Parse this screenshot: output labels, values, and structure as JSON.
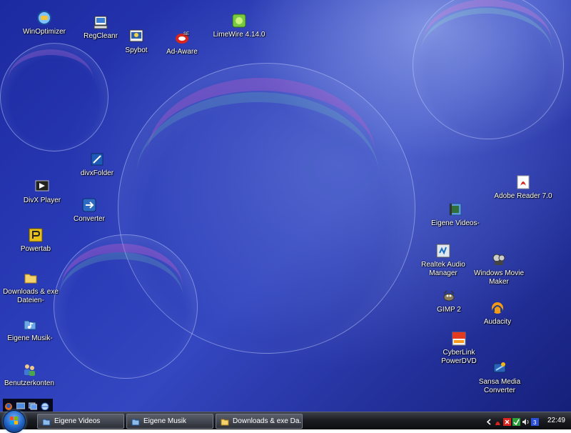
{
  "desktop": {
    "icons": [
      {
        "label": "WinOptimizer",
        "icon": "winoptimizer-icon"
      },
      {
        "label": "RegCleanr",
        "icon": "regcleanr-icon"
      },
      {
        "label": "Spybot",
        "icon": "spybot-icon"
      },
      {
        "label": "Ad-Aware",
        "icon": "ad-aware-icon"
      },
      {
        "label": "LimeWire 4.14.0",
        "icon": "limewire-icon"
      },
      {
        "label": "divxFolder",
        "icon": "divx-folder-icon"
      },
      {
        "label": "DivX Player",
        "icon": "divx-player-icon"
      },
      {
        "label": "Converter",
        "icon": "converter-icon"
      },
      {
        "label": "Powertab",
        "icon": "powertab-icon"
      },
      {
        "label": "Downloads & exe Dateien-",
        "icon": "folder-icon"
      },
      {
        "label": "Eigene Musik-",
        "icon": "music-folder-icon"
      },
      {
        "label": "Benutzerkonten",
        "icon": "user-accounts-icon"
      },
      {
        "label": "Adobe Reader 7.0",
        "icon": "adobe-reader-icon"
      },
      {
        "label": "Eigene Videos-",
        "icon": "videos-folder-icon"
      },
      {
        "label": "Realtek Audio Manager",
        "icon": "realtek-audio-icon"
      },
      {
        "label": "Windows Movie Maker",
        "icon": "movie-maker-icon"
      },
      {
        "label": "GIMP 2",
        "icon": "gimp-icon"
      },
      {
        "label": "Audacity",
        "icon": "audacity-icon"
      },
      {
        "label": "CyberLink PowerDVD",
        "icon": "powerdvd-icon"
      },
      {
        "label": "Sansa Media Converter",
        "icon": "sansa-converter-icon"
      }
    ]
  },
  "taskbar": {
    "start_icon": "windows-start-orb-icon",
    "quick_launch": [
      "firefox-icon",
      "show-desktop-icon",
      "switch-windows-icon",
      "internet-icon"
    ],
    "tasks": [
      {
        "label": "Eigene Videos",
        "icon": "videos-folder-icon"
      },
      {
        "label": "Eigene Musik",
        "icon": "music-folder-icon"
      },
      {
        "label": "Downloads & exe Da...",
        "icon": "folder-icon"
      }
    ],
    "tray_icons": [
      "chevron-left-icon",
      "adobe-tray-icon",
      "antivirus-tray-icon",
      "check-tray-icon",
      "volume-icon",
      "network-icon"
    ],
    "clock": "22:49"
  },
  "colors": {
    "wallpaper_blue": "#2b3cb8",
    "taskbar_dark": "#1b1d22",
    "icon_text": "#ffffff"
  }
}
